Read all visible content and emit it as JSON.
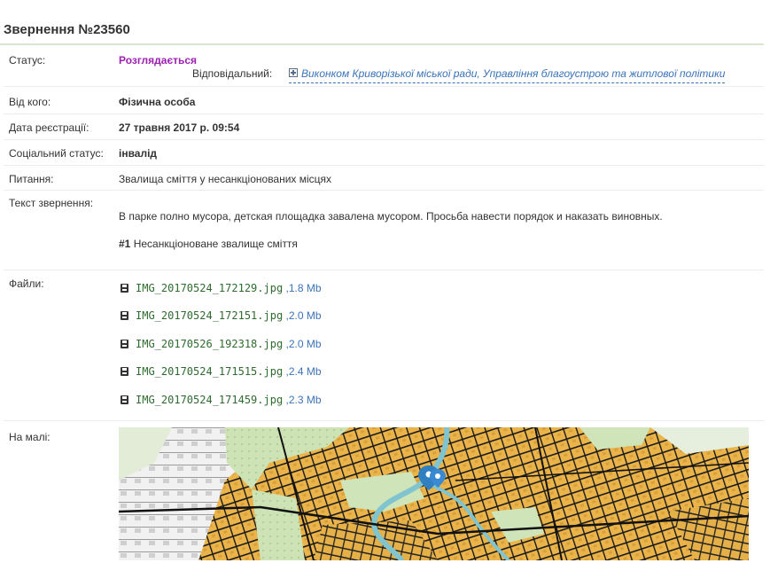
{
  "appeal": {
    "title": "Звернення №23560"
  },
  "fields": {
    "status": {
      "label": "Статус:",
      "value": "Розглядається"
    },
    "responsible": {
      "label": "Відповідальний:",
      "value": "Виконком Криворізької міської ради, Управління благоустрою та житлової політики"
    },
    "from": {
      "label": "Від кого:",
      "value": "Фізична особа"
    },
    "reg_date": {
      "label": "Дата реєстрації:",
      "value": "27 травня 2017 р. 09:54"
    },
    "social_status": {
      "label": "Соціальний статус:",
      "value": "інвалід"
    },
    "topic": {
      "label": "Питання:",
      "value": "Звалища сміття у несанкціонованих місцях"
    },
    "text": {
      "label": "Текст звернення:",
      "body": "В парке полно мусора, детская площадка завалена мусором. Просьба навести порядок и наказать виновных.",
      "category_num": "#1",
      "category": "Несанкціоноване звалище сміття"
    },
    "files": {
      "label": "Файли:",
      "items": [
        {
          "name": "IMG_20170524_172129.jpg",
          "size": ",1.8 Mb"
        },
        {
          "name": "IMG_20170524_172151.jpg",
          "size": ",2.0 Mb"
        },
        {
          "name": "IMG_20170526_192318.jpg",
          "size": ",2.0 Mb"
        },
        {
          "name": "IMG_20170524_171515.jpg",
          "size": ",2.4 Mb"
        },
        {
          "name": "IMG_20170524_171459.jpg",
          "size": ",2.3 Mb"
        }
      ]
    },
    "map": {
      "label": "На малі:"
    }
  },
  "icons": {
    "file": "save-icon",
    "expand": "plus-square-icon",
    "marker": "map-marker-icon"
  },
  "colors": {
    "status": "#9b1fb0",
    "link": "#3b73b9",
    "filename": "#2e6b2e",
    "map_urban": "#e8b54a",
    "map_green": "#c6dfb0",
    "map_water": "#7fc4cf",
    "marker": "#2f7fc1"
  }
}
